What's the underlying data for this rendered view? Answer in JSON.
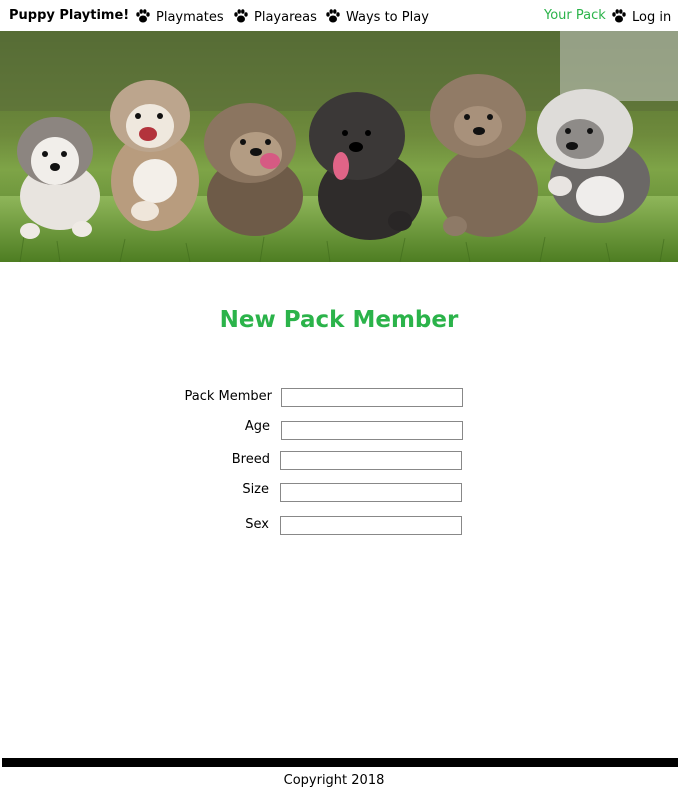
{
  "nav": {
    "brand": "Puppy Playtime!",
    "items": [
      {
        "label": "Playmates",
        "icon": "paw-icon"
      },
      {
        "label": "Playareas",
        "icon": "paw-icon"
      },
      {
        "label": "Ways to Play",
        "icon": "paw-icon"
      }
    ],
    "your_pack": "Your Pack",
    "login": "Log in"
  },
  "colors": {
    "accent": "#2bb34a",
    "footer_bar": "#000000"
  },
  "hero": {
    "description_icon": "puppies-banner-image"
  },
  "page_title": "New Pack Member",
  "form": {
    "fields": [
      {
        "label": "Pack Member",
        "value": "",
        "placeholder": ""
      },
      {
        "label": "Age",
        "value": "",
        "placeholder": ""
      },
      {
        "label": "Breed",
        "value": "",
        "placeholder": ""
      },
      {
        "label": "Size",
        "value": "",
        "placeholder": ""
      },
      {
        "label": "Sex",
        "value": "",
        "placeholder": ""
      }
    ]
  },
  "footer": {
    "copyright": "Copyright 2018"
  }
}
